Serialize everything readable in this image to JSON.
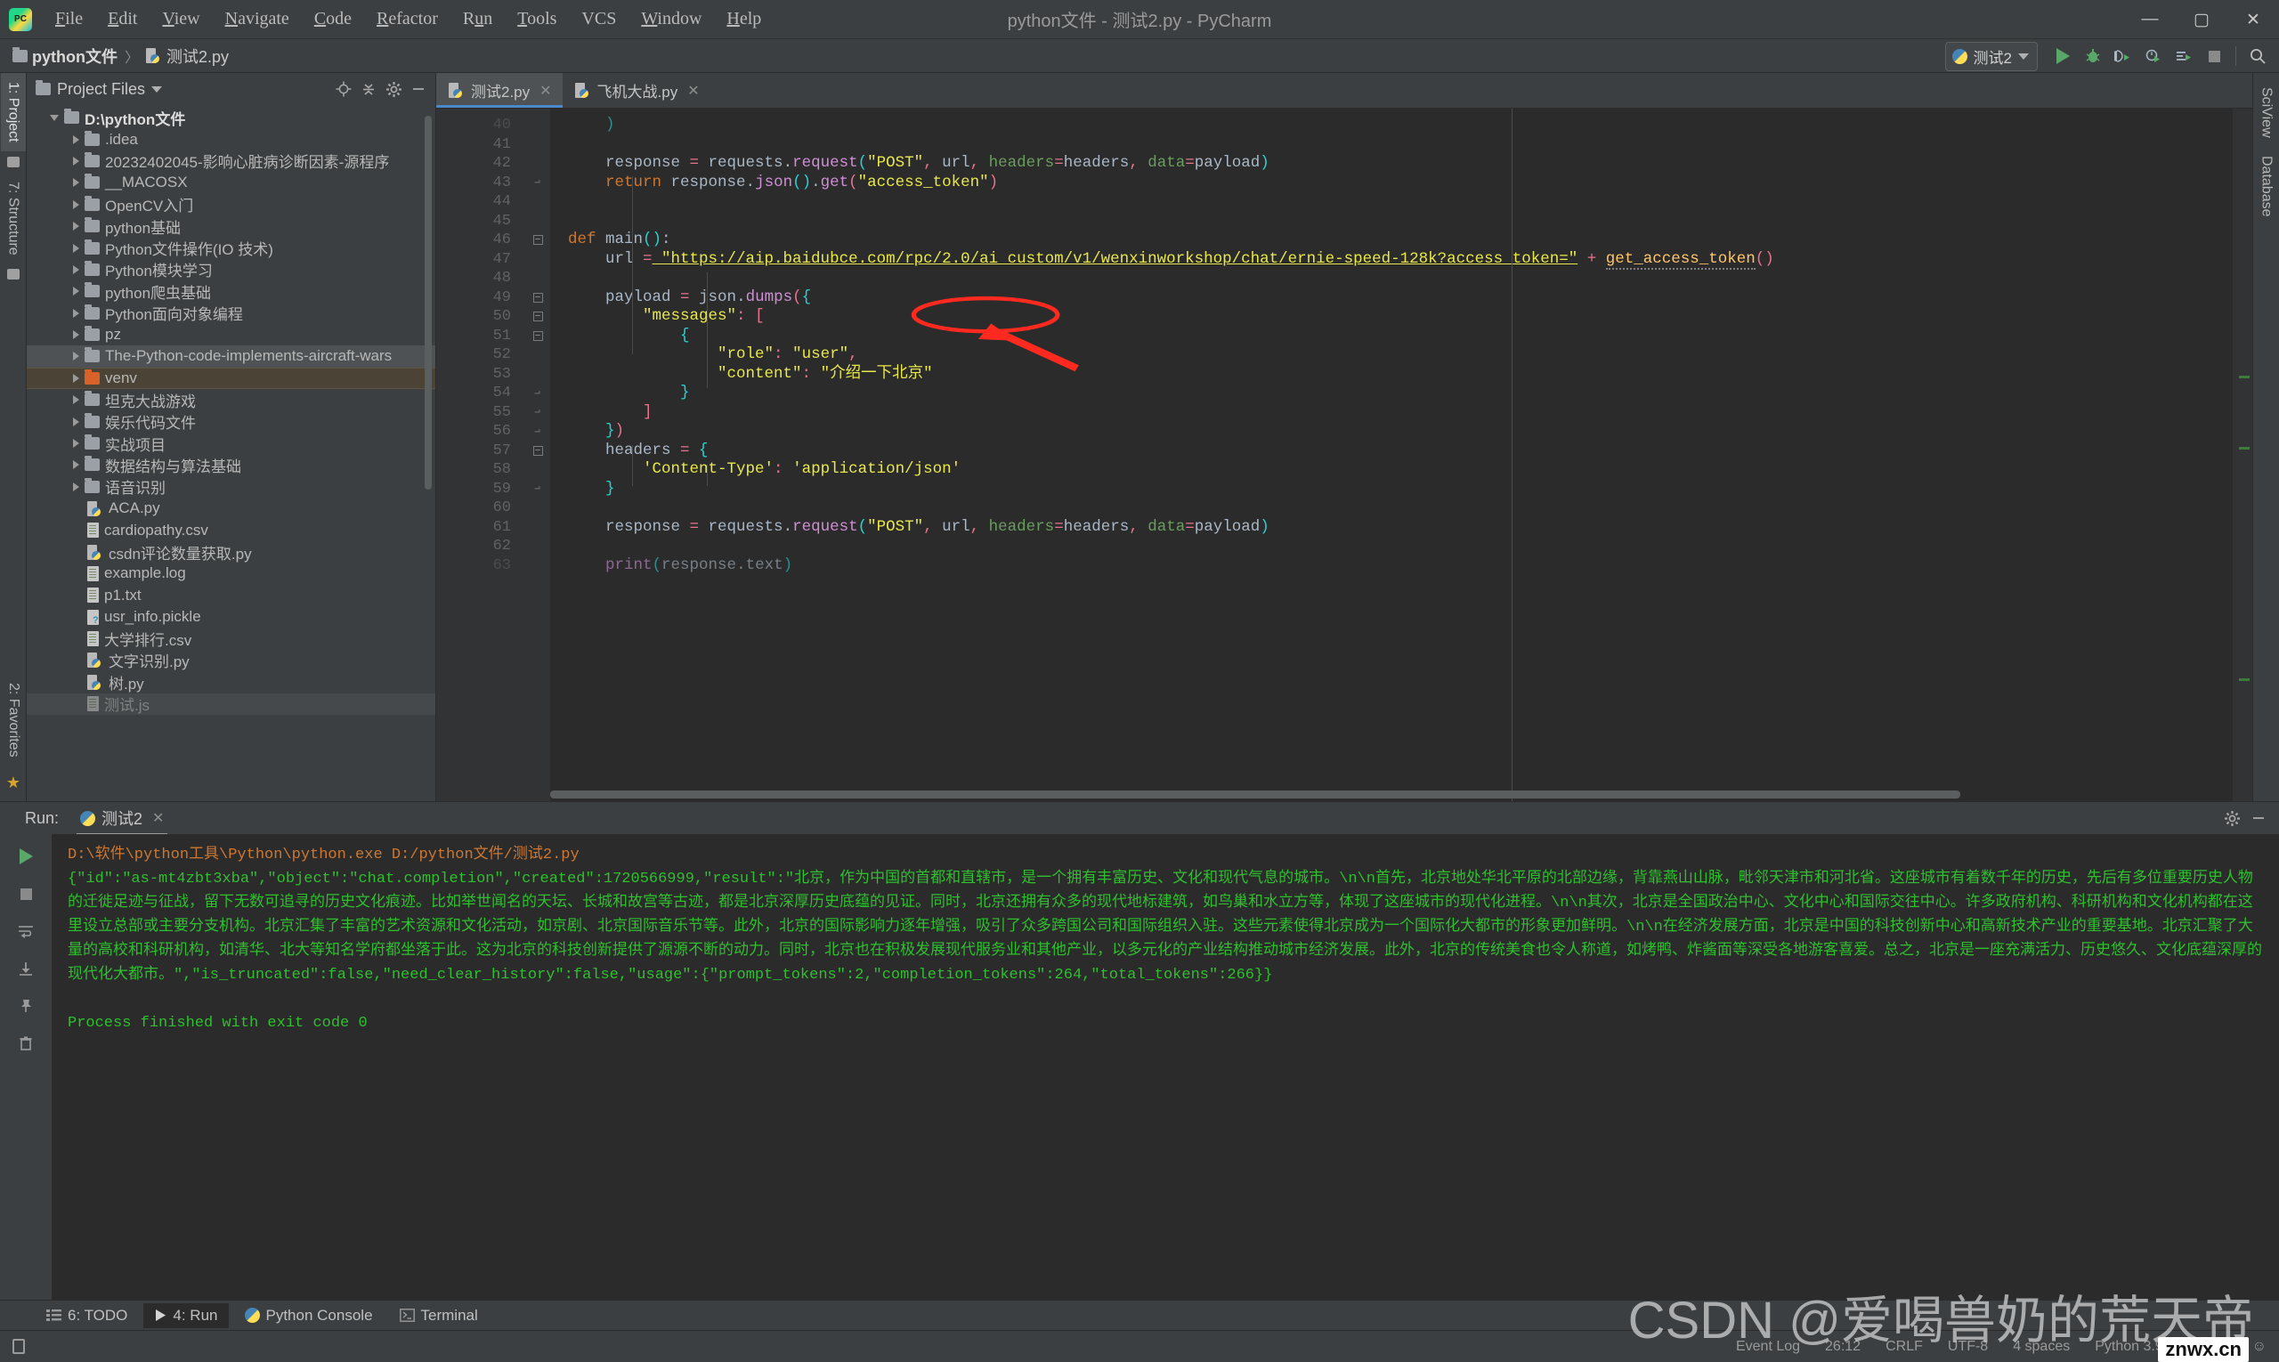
{
  "window": {
    "title": "python文件 - 测试2.py - PyCharm",
    "logo_text": "PC",
    "minimize": "—",
    "maximize": "▢",
    "close": "✕"
  },
  "menubar": {
    "items": [
      {
        "label": "File",
        "mnemonic": "F"
      },
      {
        "label": "Edit",
        "mnemonic": "E"
      },
      {
        "label": "View",
        "mnemonic": "V"
      },
      {
        "label": "Navigate",
        "mnemonic": "N"
      },
      {
        "label": "Code",
        "mnemonic": "C"
      },
      {
        "label": "Refactor",
        "mnemonic": "R"
      },
      {
        "label": "Run",
        "mnemonic": "u"
      },
      {
        "label": "Tools",
        "mnemonic": "T"
      },
      {
        "label": "VCS",
        "mnemonic": ""
      },
      {
        "label": "Window",
        "mnemonic": "W"
      },
      {
        "label": "Help",
        "mnemonic": "H"
      }
    ]
  },
  "breadcrumb": {
    "root": "python文件",
    "separator": "〉",
    "file": "测试2.py"
  },
  "toolbar": {
    "run_config": "测试2",
    "icons": [
      {
        "name": "run-icon",
        "glyph": "▶"
      },
      {
        "name": "debug-icon",
        "glyph": "🐞"
      },
      {
        "name": "run-with-coverage-icon",
        "glyph": "◖"
      },
      {
        "name": "profile-icon",
        "glyph": "◷"
      },
      {
        "name": "run-dashboard-icon",
        "glyph": "≡"
      },
      {
        "name": "stop-icon",
        "glyph": "■"
      },
      {
        "name": "search-everywhere-icon",
        "glyph": "🔍"
      }
    ]
  },
  "left_rail": {
    "project_tab": "1: Project",
    "structure_tab": "7: Structure",
    "favorites_tab": "2: Favorites"
  },
  "right_rail": {
    "sciview_tab": "SciView",
    "database_tab": "Database"
  },
  "project_panel": {
    "title": "Project Files",
    "header_icons": [
      {
        "name": "locate-icon",
        "glyph": "⊕"
      },
      {
        "name": "collapse-all-icon",
        "glyph": "⤓"
      },
      {
        "name": "settings-gear-icon",
        "glyph": "⚙"
      },
      {
        "name": "hide-icon",
        "glyph": "—"
      }
    ],
    "tree": [
      {
        "label": "D:\\python文件",
        "type": "folder",
        "expanded": true,
        "depth": 0,
        "root": true
      },
      {
        "label": ".idea",
        "type": "folder",
        "depth": 1
      },
      {
        "label": "20232402045-影响心脏病诊断因素-源程序",
        "type": "folder",
        "depth": 1
      },
      {
        "label": "__MACOSX",
        "type": "folder",
        "depth": 1
      },
      {
        "label": "OpenCV入门",
        "type": "folder",
        "depth": 1
      },
      {
        "label": "python基础",
        "type": "folder",
        "depth": 1
      },
      {
        "label": "Python文件操作(IO 技术)",
        "type": "folder",
        "depth": 1
      },
      {
        "label": "Python模块学习",
        "type": "folder",
        "depth": 1
      },
      {
        "label": "python爬虫基础",
        "type": "folder",
        "depth": 1
      },
      {
        "label": "Python面向对象编程",
        "type": "folder",
        "depth": 1
      },
      {
        "label": "pz",
        "type": "folder",
        "depth": 1
      },
      {
        "label": "The-Python-code-implements-aircraft-wars",
        "type": "folder",
        "depth": 1
      },
      {
        "label": "venv",
        "type": "folder",
        "depth": 1,
        "selected": true,
        "orange": true
      },
      {
        "label": "坦克大战游戏",
        "type": "folder",
        "depth": 1
      },
      {
        "label": "娱乐代码文件",
        "type": "folder",
        "depth": 1
      },
      {
        "label": "实战项目",
        "type": "folder",
        "depth": 1
      },
      {
        "label": "数据结构与算法基础",
        "type": "folder",
        "depth": 1
      },
      {
        "label": "语音识别",
        "type": "folder",
        "depth": 1
      },
      {
        "label": "ACA.py",
        "type": "python",
        "depth": 2
      },
      {
        "label": "cardiopathy.csv",
        "type": "file",
        "depth": 2
      },
      {
        "label": "csdn评论数量获取.py",
        "type": "python",
        "depth": 2
      },
      {
        "label": "example.log",
        "type": "file",
        "depth": 2
      },
      {
        "label": "p1.txt",
        "type": "file",
        "depth": 2
      },
      {
        "label": "usr_info.pickle",
        "type": "unknown",
        "depth": 2
      },
      {
        "label": "大学排行.csv",
        "type": "file",
        "depth": 2
      },
      {
        "label": "文字识别.py",
        "type": "python",
        "depth": 2
      },
      {
        "label": "树.py",
        "type": "python",
        "depth": 2
      },
      {
        "label": "测试.js",
        "type": "file",
        "depth": 2,
        "partial": true
      }
    ]
  },
  "editor": {
    "tabs": [
      {
        "label": "测试2.py",
        "active": true,
        "close": "✕"
      },
      {
        "label": "飞机大战.py",
        "active": false,
        "close": "✕"
      }
    ],
    "first_line_number": 40,
    "lines": [
      {
        "num": 40,
        "partial": true,
        "tokens": [
          {
            "t": "    ",
            "c": "k-punct"
          },
          {
            "t": ")",
            "c": "k-brk"
          }
        ]
      },
      {
        "num": 41,
        "tokens": []
      },
      {
        "num": 42,
        "tokens": [
          {
            "t": "    response ",
            "c": "k-id"
          },
          {
            "t": "=",
            "c": "k-op"
          },
          {
            "t": " requests",
            "c": "k-id"
          },
          {
            "t": ".",
            "c": "k-punct"
          },
          {
            "t": "request",
            "c": "k-fn"
          },
          {
            "t": "(",
            "c": "k-brk"
          },
          {
            "t": "\"POST\"",
            "c": "k-str"
          },
          {
            "t": ",",
            "c": "k-op"
          },
          {
            "t": " url",
            "c": "k-id"
          },
          {
            "t": ",",
            "c": "k-op"
          },
          {
            "t": " headers",
            "c": "k-kwarg"
          },
          {
            "t": "=",
            "c": "k-op"
          },
          {
            "t": "headers",
            "c": "k-id"
          },
          {
            "t": ",",
            "c": "k-op"
          },
          {
            "t": " data",
            "c": "k-kwarg"
          },
          {
            "t": "=",
            "c": "k-op"
          },
          {
            "t": "payload",
            "c": "k-id"
          },
          {
            "t": ")",
            "c": "k-brk"
          }
        ]
      },
      {
        "num": 43,
        "fold": "end",
        "tokens": [
          {
            "t": "    ",
            "c": "k-id"
          },
          {
            "t": "return",
            "c": "k-kw"
          },
          {
            "t": " response",
            "c": "k-id"
          },
          {
            "t": ".",
            "c": "k-punct"
          },
          {
            "t": "json",
            "c": "k-fn"
          },
          {
            "t": "()",
            "c": "k-brk"
          },
          {
            "t": ".",
            "c": "k-punct"
          },
          {
            "t": "get",
            "c": "k-fn"
          },
          {
            "t": "(",
            "c": "k-brk2"
          },
          {
            "t": "\"access_token\"",
            "c": "k-str"
          },
          {
            "t": ")",
            "c": "k-brk2"
          }
        ]
      },
      {
        "num": 44,
        "tokens": []
      },
      {
        "num": 45,
        "tokens": []
      },
      {
        "num": 46,
        "fold": "start",
        "tokens": [
          {
            "t": "def",
            "c": "k-def"
          },
          {
            "t": " main",
            "c": "k-id"
          },
          {
            "t": "()",
            "c": "k-brk"
          },
          {
            "t": ":",
            "c": "k-punct"
          }
        ]
      },
      {
        "num": 47,
        "tokens": [
          {
            "t": "    url ",
            "c": "k-id"
          },
          {
            "t": "=",
            "c": "k-op"
          },
          {
            "t": " \"https://aip.baidubce.com/rpc/2.0/ai_custom/v1/wenxinworkshop/chat/ernie-speed-128k?access_token=\"",
            "c": "k-urlstr"
          },
          {
            "t": " + ",
            "c": "k-op"
          },
          {
            "t": "get_access_token",
            "c": "k-warn"
          },
          {
            "t": "()",
            "c": "k-brk2"
          }
        ]
      },
      {
        "num": 48,
        "tokens": []
      },
      {
        "num": 49,
        "fold": "start",
        "tokens": [
          {
            "t": "    payload ",
            "c": "k-id"
          },
          {
            "t": "=",
            "c": "k-op"
          },
          {
            "t": " json",
            "c": "k-id"
          },
          {
            "t": ".",
            "c": "k-punct"
          },
          {
            "t": "dumps",
            "c": "k-fn"
          },
          {
            "t": "(",
            "c": "k-brk2"
          },
          {
            "t": "{",
            "c": "k-brk"
          }
        ]
      },
      {
        "num": 50,
        "fold": "start",
        "tokens": [
          {
            "t": "        ",
            "c": "k-id"
          },
          {
            "t": "\"messages\"",
            "c": "k-str"
          },
          {
            "t": ":",
            "c": "k-op"
          },
          {
            "t": " [",
            "c": "k-brk2"
          }
        ]
      },
      {
        "num": 51,
        "fold": "start",
        "tokens": [
          {
            "t": "            ",
            "c": "k-id"
          },
          {
            "t": "{",
            "c": "k-brk"
          }
        ]
      },
      {
        "num": 52,
        "tokens": [
          {
            "t": "                ",
            "c": "k-id"
          },
          {
            "t": "\"role\"",
            "c": "k-str"
          },
          {
            "t": ":",
            "c": "k-op"
          },
          {
            "t": " \"user\"",
            "c": "k-str"
          },
          {
            "t": ",",
            "c": "k-op"
          }
        ]
      },
      {
        "num": 53,
        "highlight": true,
        "tokens": [
          {
            "t": "                ",
            "c": "k-id"
          },
          {
            "t": "\"content\"",
            "c": "k-str"
          },
          {
            "t": ":",
            "c": "k-op"
          },
          {
            "t": " \"介绍一下北京\"",
            "c": "k-str"
          }
        ]
      },
      {
        "num": 54,
        "fold": "end",
        "tokens": [
          {
            "t": "            ",
            "c": "k-id"
          },
          {
            "t": "}",
            "c": "k-brk"
          }
        ]
      },
      {
        "num": 55,
        "fold": "end",
        "tokens": [
          {
            "t": "        ",
            "c": "k-id"
          },
          {
            "t": "]",
            "c": "k-brk2"
          }
        ]
      },
      {
        "num": 56,
        "fold": "end",
        "tokens": [
          {
            "t": "    ",
            "c": "k-id"
          },
          {
            "t": "}",
            "c": "k-brk"
          },
          {
            "t": ")",
            "c": "k-brk2"
          }
        ]
      },
      {
        "num": 57,
        "fold": "start",
        "tokens": [
          {
            "t": "    headers ",
            "c": "k-id"
          },
          {
            "t": "=",
            "c": "k-op"
          },
          {
            "t": " {",
            "c": "k-brk"
          }
        ]
      },
      {
        "num": 58,
        "tokens": [
          {
            "t": "        ",
            "c": "k-id"
          },
          {
            "t": "'Content-Type'",
            "c": "k-str"
          },
          {
            "t": ":",
            "c": "k-op"
          },
          {
            "t": " 'application/json'",
            "c": "k-str"
          }
        ]
      },
      {
        "num": 59,
        "fold": "end",
        "tokens": [
          {
            "t": "    ",
            "c": "k-id"
          },
          {
            "t": "}",
            "c": "k-brk"
          }
        ]
      },
      {
        "num": 60,
        "tokens": []
      },
      {
        "num": 61,
        "tokens": [
          {
            "t": "    response ",
            "c": "k-id"
          },
          {
            "t": "=",
            "c": "k-op"
          },
          {
            "t": " requests",
            "c": "k-id"
          },
          {
            "t": ".",
            "c": "k-punct"
          },
          {
            "t": "request",
            "c": "k-fn"
          },
          {
            "t": "(",
            "c": "k-brk"
          },
          {
            "t": "\"POST\"",
            "c": "k-str"
          },
          {
            "t": ",",
            "c": "k-op"
          },
          {
            "t": " url",
            "c": "k-id"
          },
          {
            "t": ",",
            "c": "k-op"
          },
          {
            "t": " headers",
            "c": "k-kwarg"
          },
          {
            "t": "=",
            "c": "k-op"
          },
          {
            "t": "headers",
            "c": "k-id"
          },
          {
            "t": ",",
            "c": "k-op"
          },
          {
            "t": " data",
            "c": "k-kwarg"
          },
          {
            "t": "=",
            "c": "k-op"
          },
          {
            "t": "payload",
            "c": "k-id"
          },
          {
            "t": ")",
            "c": "k-brk"
          }
        ]
      },
      {
        "num": 62,
        "tokens": []
      },
      {
        "num": 63,
        "clipped": true,
        "tokens": [
          {
            "t": "    ",
            "c": "k-id"
          },
          {
            "t": "print",
            "c": "k-fn"
          },
          {
            "t": "(",
            "c": "k-brk"
          },
          {
            "t": "response",
            "c": "k-id"
          },
          {
            "t": ".",
            "c": "k-punct"
          },
          {
            "t": "text",
            "c": "k-id"
          },
          {
            "t": ")",
            "c": "k-brk"
          }
        ]
      }
    ]
  },
  "annotation": {
    "ellipse_target": "\"介绍一下北京\"",
    "color": "#ff2a1f"
  },
  "run_panel": {
    "label": "Run:",
    "tab_name": "测试2",
    "tab_close": "✕",
    "sidebar_icons": [
      {
        "name": "rerun-icon",
        "glyph": "▶"
      },
      {
        "name": "stop-icon",
        "glyph": "■"
      },
      {
        "name": "soft-wrap-icon",
        "glyph": "↵"
      },
      {
        "name": "scroll-to-end-icon",
        "glyph": "⤓"
      },
      {
        "name": "pin-icon",
        "glyph": "📌"
      },
      {
        "name": "trash-icon",
        "glyph": "🗑"
      }
    ],
    "header_icons": [
      {
        "name": "settings-gear-icon",
        "glyph": "⚙"
      },
      {
        "name": "hide-icon",
        "glyph": "—"
      }
    ],
    "command": "D:\\软件\\python工具\\Python\\python.exe D:/python文件/测试2.py",
    "output": "{\"id\":\"as-mt4zbt3xba\",\"object\":\"chat.completion\",\"created\":1720566999,\"result\":\"北京，作为中国的首都和直辖市，是一个拥有丰富历史、文化和现代气息的城市。\\n\\n首先，北京地处华北平原的北部边缘，背靠燕山山脉，毗邻天津市和河北省。这座城市有着数千年的历史，先后有多位重要历史人物的迁徙足迹与征战，留下无数可追寻的历史文化痕迹。比如举世闻名的天坛、长城和故宫等古迹，都是北京深厚历史底蕴的见证。同时，北京还拥有众多的现代地标建筑，如鸟巢和水立方等，体现了这座城市的现代化进程。\\n\\n其次，北京是全国政治中心、文化中心和国际交往中心。许多政府机构、科研机构和文化机构都在这里设立总部或主要分支机构。北京汇集了丰富的艺术资源和文化活动，如京剧、北京国际音乐节等。此外，北京的国际影响力逐年增强，吸引了众多跨国公司和国际组织入驻。这些元素使得北京成为一个国际化大都市的形象更加鲜明。\\n\\n在经济发展方面，北京是中国的科技创新中心和高新技术产业的重要基地。北京汇聚了大量的高校和科研机构，如清华、北大等知名学府都坐落于此。这为北京的科技创新提供了源源不断的动力。同时，北京也在积极发展现代服务业和其他产业，以多元化的产业结构推动城市经济发展。此外，北京的传统美食也令人称道，如烤鸭、炸酱面等深受各地游客喜爱。总之，北京是一座充满活力、历史悠久、文化底蕴深厚的现代化大都市。\",\"is_truncated\":false,\"need_clear_history\":false,\"usage\":{\"prompt_tokens\":2,\"completion_tokens\":264,\"total_tokens\":266}}",
    "finish_message": "Process finished with exit code 0"
  },
  "toolwindow_bar": {
    "items": [
      {
        "label": "6: TODO",
        "icon": "todo-icon",
        "active": false
      },
      {
        "label": "4: Run",
        "icon": "run-icon",
        "active": true
      },
      {
        "label": "Python Console",
        "icon": "python-icon",
        "active": false
      },
      {
        "label": "Terminal",
        "icon": "terminal-icon",
        "active": false
      }
    ]
  },
  "statusbar": {
    "event_log": "Event Log",
    "position": "26:12",
    "line_sep": "CRLF",
    "encoding": "UTF-8",
    "indent": "4 spaces",
    "interpreter": "Python 3.9 (4)"
  },
  "watermark": {
    "text": "CSDN @爱喝兽奶的荒天帝",
    "badge": "znwx.cn"
  }
}
